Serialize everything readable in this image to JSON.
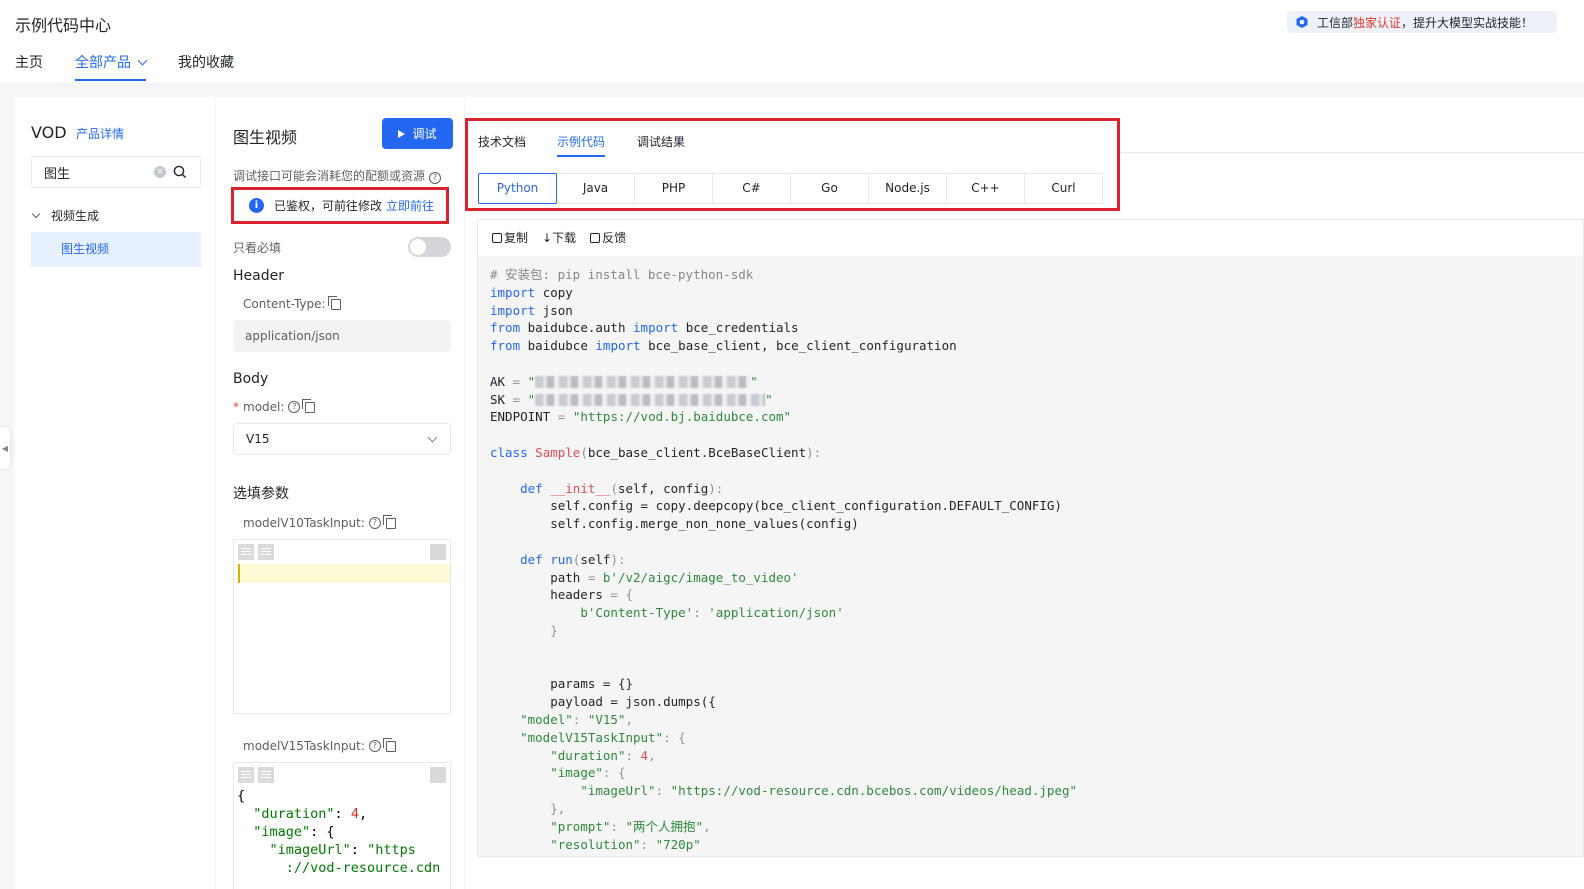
{
  "app": {
    "title": "示例代码中心",
    "notice_prefix": "工信部",
    "notice_highlight": "独家认证",
    "notice_suffix": "，提升大模型实战技能！"
  },
  "nav": {
    "tabs": [
      {
        "label": "主页"
      },
      {
        "label": "全部产品"
      },
      {
        "label": "我的收藏"
      }
    ],
    "active_index": 1
  },
  "sidebar": {
    "product": "VOD",
    "product_link": "产品详情",
    "search_value": "图生",
    "group_label": "视频生成",
    "item_label": "图生视频"
  },
  "api_panel": {
    "title": "图生视频",
    "debug_button": "调试",
    "cost_tip": "调试接口可能会消耗您的配额或资源",
    "auth_text": "已鉴权，可前往修改",
    "auth_link": "立即前往",
    "required_only": "只看必填",
    "header_title": "Header",
    "content_type_label": "Content-Type:",
    "content_type_value": "application/json",
    "body_title": "Body",
    "model_label": "model:",
    "model_value": "V15",
    "optional_title": "选填参数",
    "v10_label": "modelV10TaskInput:",
    "v15_label": "modelV15TaskInput:",
    "v15_json": {
      "l1": "{",
      "l2_key": "\"duration\"",
      "l2_val": "4",
      "l3_key": "\"image\"",
      "l4_key": "\"imageUrl\"",
      "l4_val": "\"https",
      "l5_val": "://vod-resource.cdn"
    }
  },
  "code_panel": {
    "tabs": [
      {
        "label": "技术文档"
      },
      {
        "label": "示例代码"
      },
      {
        "label": "调试结果"
      }
    ],
    "active_tab": 1,
    "languages": [
      "Python",
      "Java",
      "PHP",
      "C#",
      "Go",
      "Node.js",
      "C++",
      "Curl"
    ],
    "active_language": 0,
    "tools": [
      {
        "label": "复制",
        "icon": "copy-icon"
      },
      {
        "label": "下载",
        "icon": "download-icon"
      },
      {
        "label": "反馈",
        "icon": "feedback-icon"
      }
    ]
  },
  "code": {
    "comment": "# 安装包: pip install bce-python-sdk",
    "import1_mod": "copy",
    "import2_mod": "json",
    "from1_mod": "baidubce.auth",
    "from1_name": "bce_credentials",
    "from2_mod": "baidubce",
    "from2_names": "bce_base_client, bce_client_configuration",
    "ak_label": "AK",
    "sk_label": "SK",
    "endpoint_label": "ENDPOINT",
    "endpoint_value": "\"https://vod.bj.baidubce.com\"",
    "class_name": "Sample",
    "class_base": "bce_base_client.BceBaseClient",
    "init_sig": "self, config",
    "init_line1": "self.config = copy.deepcopy(bce_client_configuration.DEFAULT_CONFIG)",
    "init_line2": "self.config.merge_non_none_values(config)",
    "run_sig": "self",
    "path_value": "b'/v2/aigc/image_to_video'",
    "ct_key": "b'Content-Type'",
    "ct_value": "'application/json'",
    "params_line": "params = {}",
    "payload_line": "payload = json.dumps({",
    "model_key": "\"model\"",
    "model_value": "\"V15\"",
    "v15_key": "\"modelV15TaskInput\"",
    "duration_key": "\"duration\"",
    "duration_value": "4",
    "image_key": "\"image\"",
    "image_url_key": "\"imageUrl\"",
    "image_url_value": "\"https://vod-resource.cdn.bcebos.com/videos/head.jpeg\"",
    "prompt_key": "\"prompt\"",
    "prompt_value": "\"两个人拥抱\"",
    "resolution_key": "\"resolution\"",
    "resolution_value": "\"720p\""
  },
  "colors": {
    "accent": "#2468f2",
    "highlight_border": "#d9232e",
    "notice_red": "#e13a31"
  }
}
